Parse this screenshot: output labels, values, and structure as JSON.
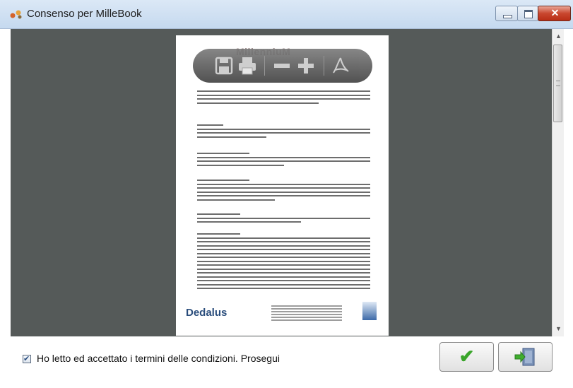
{
  "window": {
    "title": "Consenso per MilleBook",
    "controls": [
      "minimize",
      "maximize",
      "close"
    ],
    "close_glyph": "✕"
  },
  "document": {
    "brand_header": "MillenniuM",
    "footer_logo": "Dedalus",
    "toolbar_icons": [
      "save-icon",
      "print-icon",
      "zoom-out-icon",
      "zoom-in-icon",
      "acrobat-icon"
    ]
  },
  "bottom": {
    "accept_checked": true,
    "accept_label": "Ho letto ed accettato i termini delle condizioni. Prosegui",
    "ok_icon": "checkmark-icon",
    "exit_icon": "exit-door-icon"
  },
  "colors": {
    "viewer_bg": "#555a59",
    "ok_green": "#39a52a",
    "close_red": "#c9472f"
  }
}
